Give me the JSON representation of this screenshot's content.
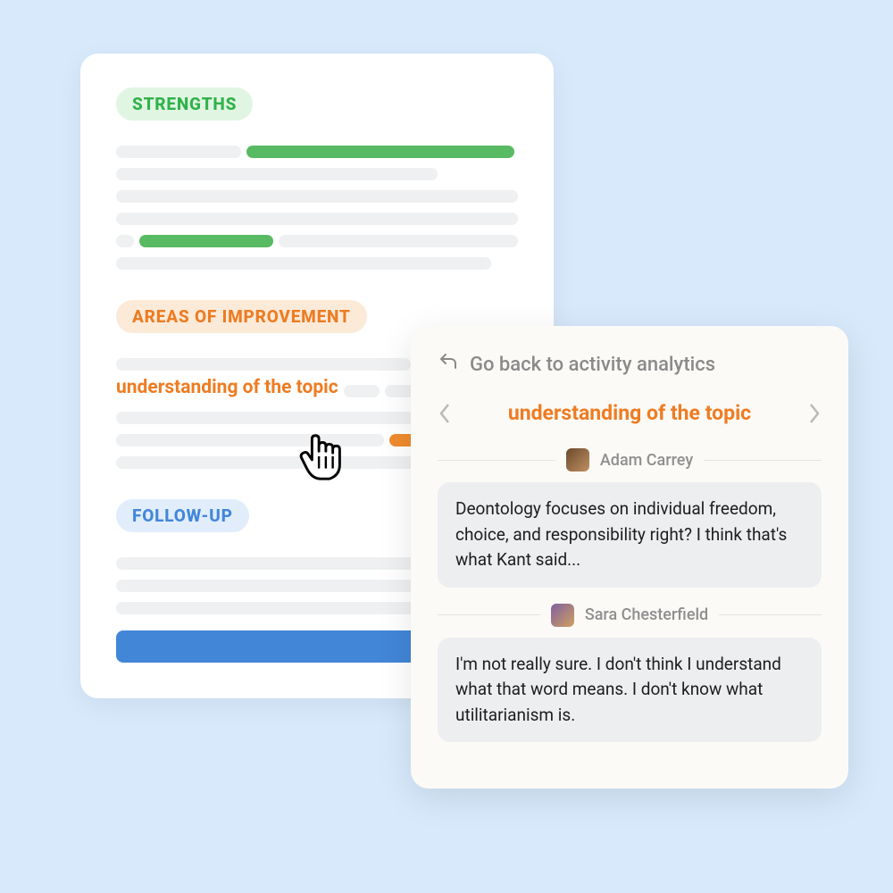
{
  "main": {
    "strengths_label": "STRENGTHS",
    "improvement_label": "AREAS OF IMPROVEMENT",
    "followup_label": "FOLLOW-UP",
    "highlighted_topic": "understanding of the topic"
  },
  "detail": {
    "go_back_label": "Go back to activity analytics",
    "topic_title": "understanding of the topic",
    "messages": [
      {
        "user": "Adam Carrey",
        "text": "Deontology focuses on individual freedom, choice, and responsibility right? I think that's what Kant said..."
      },
      {
        "user": "Sara Chesterfield",
        "text": "I'm not really sure. I don't think I understand what that word means. I don't know what utilitarianism is."
      }
    ]
  },
  "colors": {
    "green": "#58ba62",
    "orange": "#ee7c22",
    "blue": "#4286d8"
  }
}
